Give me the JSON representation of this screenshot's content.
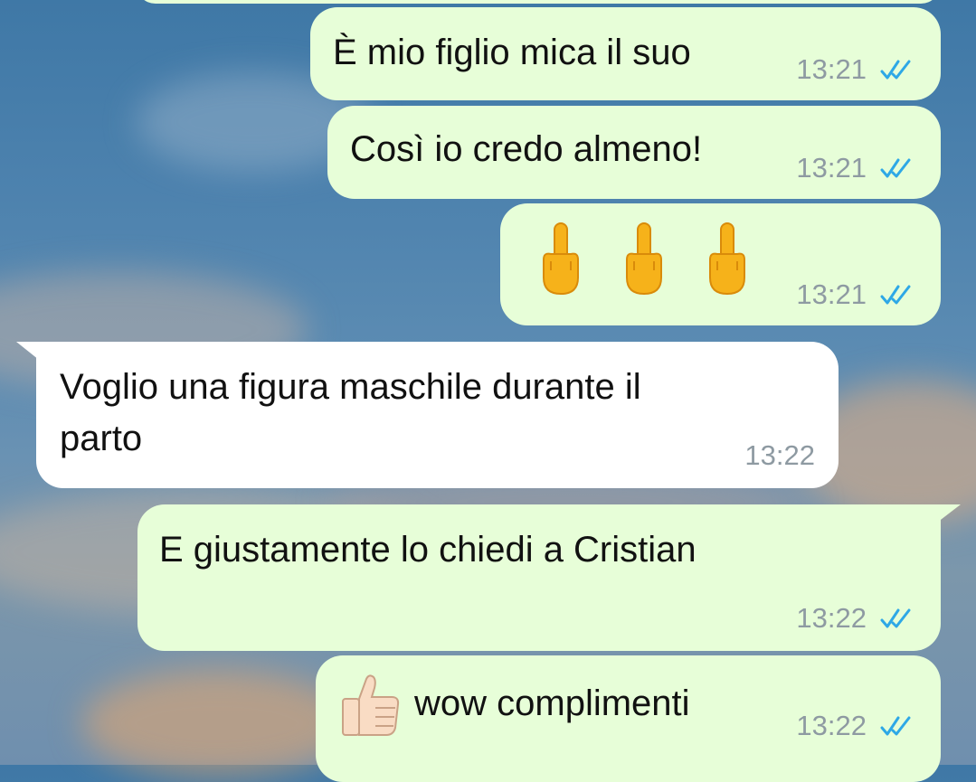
{
  "messages": [
    {
      "id": "m0",
      "direction": "outgoing",
      "text": "",
      "time": ""
    },
    {
      "id": "m1",
      "direction": "outgoing",
      "text": "È mio figlio mica il suo",
      "time": "13:21",
      "status": "read",
      "ticks_color": "#2ea8e6"
    },
    {
      "id": "m2",
      "direction": "outgoing",
      "text": "Così io credo almeno!",
      "time": "13:21",
      "status": "read",
      "ticks_color": "#2ea8e6"
    },
    {
      "id": "m3",
      "direction": "outgoing",
      "text": "🖕🖕🖕",
      "emoji": [
        "middle-finger-emoji",
        "middle-finger-emoji",
        "middle-finger-emoji"
      ],
      "time": "13:21",
      "status": "read",
      "ticks_color": "#2ea8e6"
    },
    {
      "id": "m4",
      "direction": "incoming",
      "line1": "Voglio una figura maschile durante il",
      "line2": "parto",
      "time": "13:22"
    },
    {
      "id": "m5",
      "direction": "outgoing",
      "text": "E giustamente lo chiedi a Cristian",
      "time": "13:22",
      "status": "read",
      "ticks_color": "#2ea8e6"
    },
    {
      "id": "m6",
      "direction": "outgoing",
      "emoji": "thumbs-up-emoji",
      "text": "wow complimenti",
      "time": "13:22",
      "status": "read",
      "ticks_color": "#2ea8e6"
    }
  ],
  "colors": {
    "outgoing_bubble": "#e7fed8",
    "incoming_bubble": "#ffffff",
    "time": "#8e9aa2",
    "read_ticks": "#2ea8e6"
  }
}
